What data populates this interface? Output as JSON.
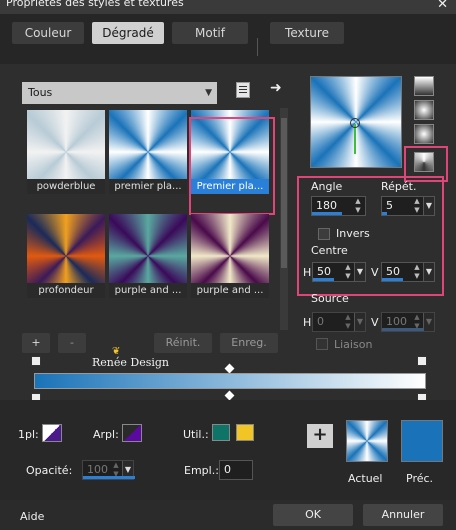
{
  "window": {
    "title": "Propriétés des styles et textures",
    "close_icon": "close-icon"
  },
  "tabs": [
    {
      "label": "Couleur"
    },
    {
      "label": "Dégradé"
    },
    {
      "label": "Motif"
    },
    {
      "label": "Texture"
    }
  ],
  "category": {
    "selected": "Tous"
  },
  "gradients": [
    {
      "name": "powderblue"
    },
    {
      "name": "premier pla..."
    },
    {
      "name": "Premier pla..."
    },
    {
      "name": "profondeur"
    },
    {
      "name": "purple and ..."
    },
    {
      "name": "purple and ..."
    }
  ],
  "library_buttons": {
    "add": "+",
    "remove": "-",
    "reset": "Réinit.",
    "save": "Enreg."
  },
  "watermark": "Renée Design",
  "settings": {
    "angle_label": "Angle",
    "angle_value": "180",
    "repeat_label": "Répét.",
    "repeat_value": "5",
    "invert_label": "Invers",
    "center_label": "Centre",
    "h_label": "H",
    "center_h": "50",
    "v_label": "V",
    "center_v": "50",
    "source_label": "Source",
    "source_h": "0",
    "source_v": "100",
    "link_label": "Liaison"
  },
  "bottom": {
    "first_label": "1pl:",
    "back_label": "Arpl:",
    "used_label": "Util.:",
    "opacity_label": "Opacité:",
    "opacity_value": "100",
    "position_label": "Empl.:",
    "position_value": "0",
    "add_button": "+",
    "current_label": "Actuel",
    "previous_label": "Préc."
  },
  "footer": {
    "help": "Aide",
    "ok": "OK",
    "cancel": "Annuler"
  },
  "colors": {
    "accent": "#2a7fd8",
    "highlight": "#e0457a",
    "used_color_1": "#0e7468",
    "used_color_2": "#f2c526",
    "previous_color": "#1a73b8"
  }
}
